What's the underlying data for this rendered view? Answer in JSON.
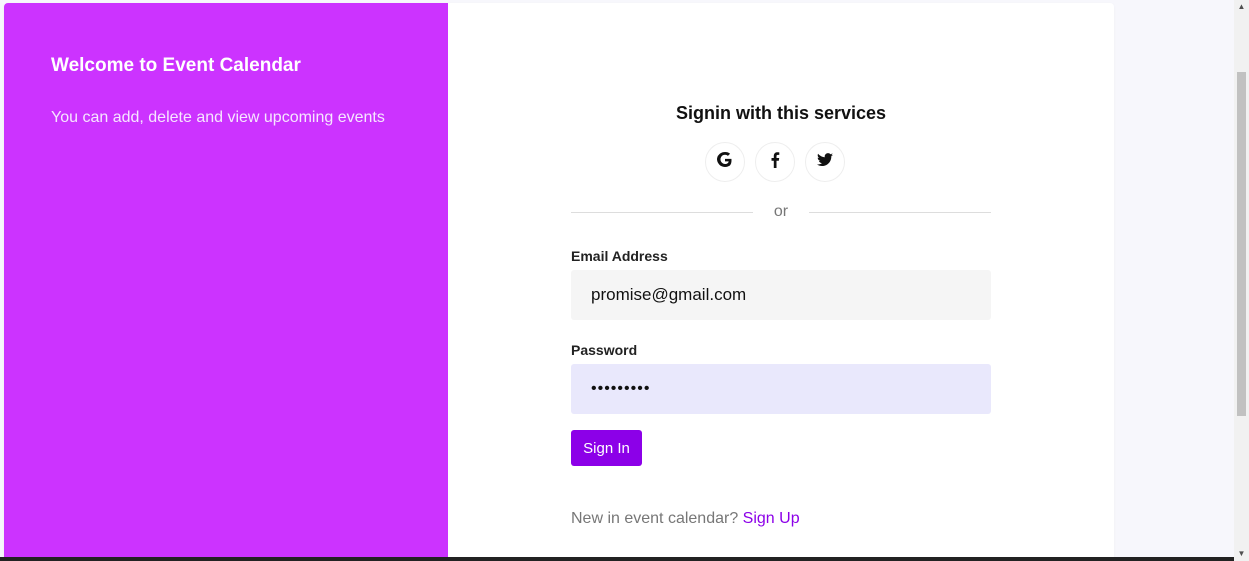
{
  "left": {
    "title": "Welcome to Event Calendar",
    "subtitle": "You can add, delete and view upcoming events",
    "bg_color": "#cc33ff"
  },
  "signin": {
    "title": "Signin with this services",
    "social": [
      {
        "name": "google",
        "icon": "google-icon"
      },
      {
        "name": "facebook",
        "icon": "facebook-icon"
      },
      {
        "name": "twitter",
        "icon": "twitter-icon"
      }
    ],
    "divider_text": "or"
  },
  "form": {
    "email_label": "Email Address",
    "email_value": "promise@gmail.com",
    "password_label": "Password",
    "password_value": "•••••••••",
    "submit_label": "Sign In"
  },
  "footer": {
    "prompt": "New in event calendar?",
    "link_label": "Sign Up"
  },
  "colors": {
    "accent": "#8c00e8",
    "password_bg": "#e9e8fc",
    "email_bg": "#f5f5f5"
  }
}
